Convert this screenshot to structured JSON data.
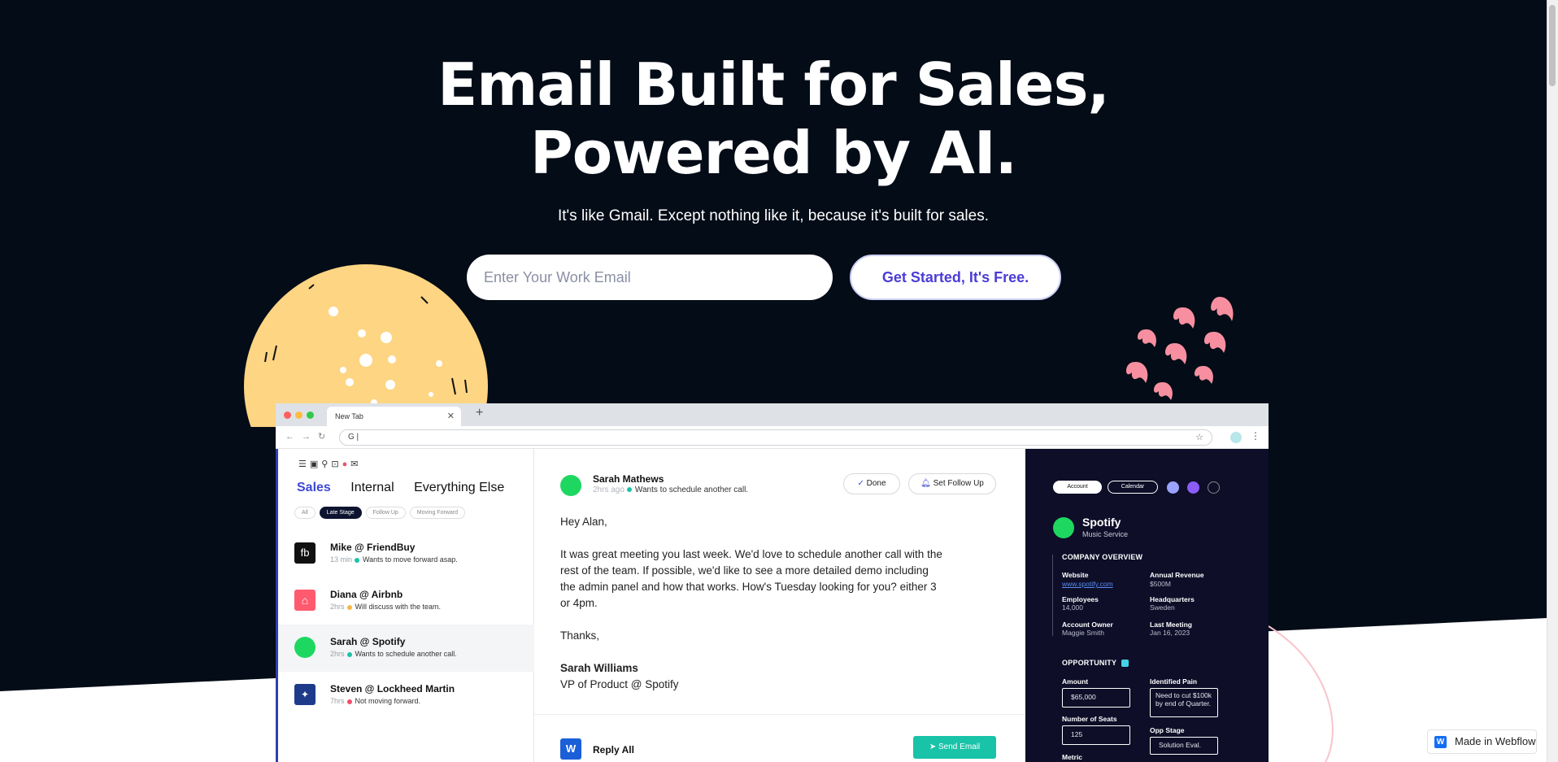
{
  "hero": {
    "title_line1": "Email Built for Sales,",
    "title_line2": "Powered by AI.",
    "subtitle": "It's like Gmail. Except nothing like it, because it's built for sales.",
    "email_placeholder": "Enter Your Work Email",
    "cta_label": "Get Started, It's Free."
  },
  "browser": {
    "tab_title": "New Tab",
    "url_value": "G |"
  },
  "left_pane": {
    "folders": [
      "Sales",
      "Internal",
      "Everything Else"
    ],
    "filters": [
      "All",
      "Late Stage",
      "Follow Up",
      "Moving Forward"
    ],
    "conversations": [
      {
        "name": "Mike @ FriendBuy",
        "time": "13 min",
        "status_color": "#19c3a8",
        "preview": "Wants to move forward asap."
      },
      {
        "name": "Diana @ Airbnb",
        "time": "2hrs",
        "status_color": "#f5b947",
        "preview": "Will discuss with the team."
      },
      {
        "name": "Sarah @ Spotify",
        "time": "2hrs",
        "status_color": "#19c3a8",
        "preview": "Wants to schedule another call."
      },
      {
        "name": "Steven @ Lockheed Martin",
        "time": "7hrs",
        "status_color": "#ef4f6a",
        "preview": "Not moving forward."
      }
    ]
  },
  "email": {
    "sender": "Sarah Mathews",
    "time": "2hrs ago",
    "status": "Wants to schedule another call.",
    "done_label": "Done",
    "followup_label": "Set Follow Up",
    "greeting": "Hey Alan,",
    "body": "It was great meeting you last week. We'd love to schedule another call with the rest of the team. If possible, we'd like to see a more detailed demo including the admin panel and how that works. How's Tuesday looking for you? either 3 or 4pm.",
    "signoff": "Thanks,",
    "sig_name": "Sarah Williams",
    "sig_title": "VP of Product @ Spotify",
    "reply_label": "Reply All",
    "send_label": "Send Email"
  },
  "crm": {
    "account_tab": "Account",
    "calendar_tab": "Calendar",
    "company_name": "Spotify",
    "company_type": "Music Service",
    "overview_title": "COMPANY OVERVIEW",
    "website_label": "Website",
    "website_value": "www.spotify.com",
    "revenue_label": "Annual Revenue",
    "revenue_value": "$500M",
    "employees_label": "Employees",
    "employees_value": "14,000",
    "hq_label": "Headquarters",
    "hq_value": "Sweden",
    "owner_label": "Account Owner",
    "owner_value": "Maggie Smith",
    "meeting_label": "Last Meeting",
    "meeting_value": "Jan 16, 2023",
    "opportunity_title": "OPPORTUNITY",
    "amount_label": "Amount",
    "amount_value": "$65,000",
    "pain_label": "Identified Pain",
    "pain_value": "Need to cut $100k by end of Quarter.",
    "seats_label": "Number of Seats",
    "seats_value": "125",
    "stage_label": "Opp Stage",
    "stage_value": "Solution Eval.",
    "metric_label": "Metric"
  },
  "webflow_badge": "Made in Webflow",
  "colors": {
    "background": "#040c17",
    "accent": "#4b3cd6",
    "green": "#19c3a8",
    "moon": "#fdd583",
    "pink": "#f78fa0"
  }
}
